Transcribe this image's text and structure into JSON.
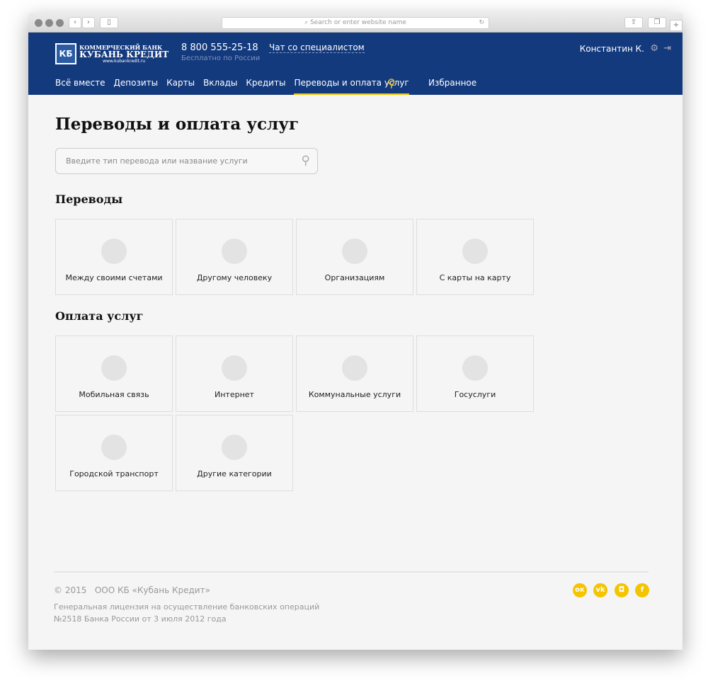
{
  "browser": {
    "url_placeholder": "Search or enter website name"
  },
  "header": {
    "logo_line1": "КОММЕРЧЕСКИЙ БАНК",
    "logo_line2": "КУБАНЬ КРЕДИТ",
    "logo_line3": "www.kubankredit.ru",
    "phone": "8 800 555-25-18",
    "phone_sub": "Бесплатно по России",
    "chat": "Чат со специалистом",
    "user": "Константин К."
  },
  "nav": {
    "items": [
      "Всё вместе",
      "Депозиты",
      "Карты",
      "Вклады",
      "Кредиты",
      "Переводы и оплата услуг"
    ],
    "favorites": "Избранное"
  },
  "page": {
    "title": "Переводы и оплата услуг",
    "search_placeholder": "Введите тип перевода или название услуги"
  },
  "transfers": {
    "title": "Переводы",
    "items": [
      "Между своими счетами",
      "Другому человеку",
      "Организациям",
      "С карты на карту"
    ]
  },
  "payments": {
    "title": "Оплата услуг",
    "items": [
      "Мобильная связь",
      "Интернет",
      "Коммунальные услуги",
      "Госуслуги",
      "Городской транспорт",
      "Другие категории"
    ]
  },
  "footer": {
    "copyright": "© 2015",
    "company": "ООО КБ «Кубань Кредит»",
    "license1": "Генеральная лицензия на осуществление банковских операций",
    "license2": "№2518 Банка России от 3 июля 2012 года",
    "social": [
      "ok",
      "vk",
      "instagram",
      "facebook"
    ]
  },
  "colors": {
    "brand": "#143a7e",
    "accent": "#f5c400"
  }
}
